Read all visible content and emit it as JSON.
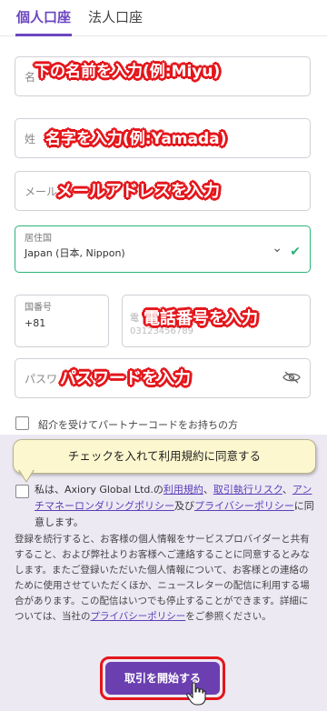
{
  "tabs": {
    "personal": "個人口座",
    "corporate": "法人口座"
  },
  "form": {
    "first_name_placeholder": "名",
    "last_name_placeholder": "姓",
    "email_placeholder": "メール",
    "country_label": "居住国",
    "country_value": "Japan (日本, Nippon)",
    "country_code_label": "国番号",
    "country_code_value": "+81",
    "phone_placeholder": "電",
    "phone_example": "03123456789",
    "password_placeholder": "パスワ"
  },
  "annotations": {
    "first_name": "下の名前を入力(例:Miyu)",
    "last_name": "名字を入力(例:Yamada)",
    "email": "メールアドレスを入力",
    "phone": "電話番号を入力",
    "password": "パスワードを入力"
  },
  "referral_label": "紹介を受けてパートナーコードをお持ちの方",
  "tooltip": "チェックを入れて利用規約に同意する",
  "agreement": {
    "prefix": "私は、Axiory Global Ltd.の",
    "terms": "利用規約",
    "sep1": "、",
    "risk": "取引執行リスク",
    "sep2": "、",
    "aml": "アンチマネーロンダリングポリシー",
    "and": "及び",
    "privacy": "プライバシーポリシー",
    "suffix": "に同意します。"
  },
  "disclaimer": {
    "text": "登録を続行すると、お客様の個人情報をサービスプロバイダーと共有すること、および弊社よりお客様へご連絡することに同意するとみなします。またご登録いただいた個人情報について、お客様との連絡のために使用させていただくほか、ニュースレターの配信に利用する場合があります。この配信はいつでも停止することができます。詳細については、当社の",
    "link": "プライバシーポリシー",
    "suffix": "をご参照ください。"
  },
  "start_button": "取引を開始する",
  "colors": {
    "accent": "#6b46c1",
    "annotation_red": "#e4161b",
    "valid_green": "#2cb37a",
    "panel_bg": "#ece9f3"
  }
}
